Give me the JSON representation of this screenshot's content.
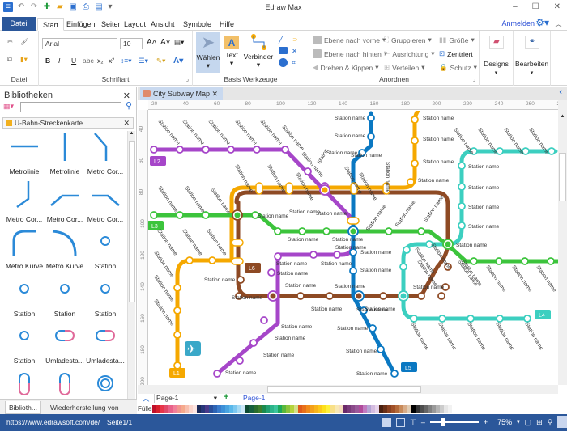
{
  "app": {
    "title": "Edraw Max",
    "window_controls": [
      "minimize-icon",
      "maximize-icon",
      "close-icon"
    ],
    "quick_access": [
      "app-logo-icon",
      "undo-icon",
      "redo-icon",
      "new-icon",
      "open-icon",
      "save-icon",
      "print-icon",
      "export-icon",
      "customize-icon"
    ]
  },
  "menu_tabs": [
    {
      "label": "Datei"
    },
    {
      "label": "Start",
      "active": true
    },
    {
      "label": "Einfügen"
    },
    {
      "label": "Seiten Layout"
    },
    {
      "label": "Ansicht"
    },
    {
      "label": "Symbole"
    },
    {
      "label": "Hilfe"
    }
  ],
  "account": {
    "signin_label": "Anmelden"
  },
  "ribbon": {
    "datei": {
      "label": "Datei"
    },
    "schriftart": {
      "label": "Schriftart",
      "font": "Arial",
      "size": "10"
    },
    "basis": {
      "label": "Basis Werkzeuge",
      "waehlen": "Wählen",
      "text": "Text",
      "verbinder": "Verbinder"
    },
    "anordnen": {
      "label": "Anordnen",
      "ebene_vorne": "Ebene nach vorne",
      "ebene_hinten": "Ebene nach hinten",
      "drehen": "Drehen & Kippen",
      "gruppieren": "Gruppieren",
      "ausrichtung": "Ausrichtung",
      "verteilen": "Verteilen",
      "groesse": "Größe",
      "zentriert": "Zentriert",
      "schutz": "Schutz"
    },
    "designs": "Designs",
    "bearbeiten": "Bearbeiten"
  },
  "sidebar": {
    "title": "Bibliotheken",
    "search_placeholder": "",
    "library": "U-Bahn-Streckenkarte",
    "shapes": [
      {
        "label": "Metrolinie",
        "kind": "h-line"
      },
      {
        "label": "Metrolinie",
        "kind": "v-line"
      },
      {
        "label": "Metro Cor...",
        "kind": "corner-a"
      },
      {
        "label": "Metro Cor...",
        "kind": "corner-b"
      },
      {
        "label": "Metro Cor...",
        "kind": "corner-c"
      },
      {
        "label": "Metro Cor...",
        "kind": "corner-d"
      },
      {
        "label": "Metro Kurve",
        "kind": "curve-a"
      },
      {
        "label": "Metro Kurve",
        "kind": "curve-b"
      },
      {
        "label": "Station",
        "kind": "station"
      },
      {
        "label": "Station",
        "kind": "station"
      },
      {
        "label": "Station",
        "kind": "station"
      },
      {
        "label": "Station",
        "kind": "station"
      },
      {
        "label": "Station",
        "kind": "station"
      },
      {
        "label": "Umladesta...",
        "kind": "transfer-h"
      },
      {
        "label": "Umladesta...",
        "kind": "transfer-h2"
      },
      {
        "label": "",
        "kind": "transfer-v"
      },
      {
        "label": "",
        "kind": "transfer-v"
      },
      {
        "label": "",
        "kind": "double-ring"
      }
    ],
    "bottom_tabs": [
      "Biblioth...",
      "Wiederherstellung von Da..."
    ]
  },
  "document": {
    "tab_title": "City Subway Map",
    "ruler_h": [
      "20",
      "40",
      "60",
      "80",
      "100",
      "120",
      "140",
      "160",
      "180",
      "200",
      "220",
      "240",
      "260",
      "28"
    ],
    "ruler_v": [
      "40",
      "60",
      "80",
      "100",
      "120",
      "140",
      "160",
      "180",
      "200"
    ],
    "station_label": "Station name",
    "short_label": "Station",
    "lines": [
      {
        "id": "L1",
        "color": "#f5a800"
      },
      {
        "id": "L2",
        "color": "#a646c9"
      },
      {
        "id": "L3",
        "color": "#3cc43c"
      },
      {
        "id": "L4",
        "color": "#3ccfc0"
      },
      {
        "id": "L5",
        "color": "#0a78c2"
      },
      {
        "id": "L6",
        "color": "#8e4a24"
      }
    ]
  },
  "pagebar": {
    "page_select": "Page-1",
    "add_icon": "plus-icon",
    "active_page": "Page-1"
  },
  "palette": {
    "label": "Füller",
    "colors": [
      "#c0102a",
      "#d8202c",
      "#e8354a",
      "#e04a6a",
      "#e8628a",
      "#f07f9a",
      "#f2958e",
      "#f5a98c",
      "#f8bfae",
      "#fbd5cc",
      "#fde6e2",
      "#1c2a5a",
      "#27367a",
      "#4a3a8a",
      "#2a4e9a",
      "#2e64b4",
      "#3a7ccc",
      "#3c90d8",
      "#4aa4e0",
      "#5ab8ea",
      "#7cc8f0",
      "#a6daf4",
      "#cce8f8",
      "#0e4a32",
      "#16603e",
      "#2a6e2e",
      "#3c7e2c",
      "#1a8a4e",
      "#22a070",
      "#2cb48a",
      "#3cc49c",
      "#1ca85a",
      "#5ab83c",
      "#8ac43c",
      "#b4d43c",
      "#d4e088",
      "#e05a1a",
      "#e8701a",
      "#f08a1a",
      "#f4a01a",
      "#f8b41a",
      "#fcc81a",
      "#fde01a",
      "#fef03a",
      "#f8e088",
      "#f8e8b4",
      "#f5dcbc",
      "#6a2a6a",
      "#7a3a7a",
      "#8a4a8a",
      "#9a5a9a",
      "#b04a9a",
      "#c07ac0",
      "#b4a4d4",
      "#d4bce0",
      "#e8d4ec",
      "#4a2010",
      "#6a3018",
      "#8a4020",
      "#a05028",
      "#b46a3a",
      "#c88a5a",
      "#d8ac88",
      "#e0ccb4",
      "#000000",
      "#333333",
      "#4d4d4d",
      "#666666",
      "#808080",
      "#999999",
      "#b3b3b3",
      "#cccccc",
      "#e6e6e6",
      "#f2f2f2"
    ]
  },
  "status": {
    "url": "https://www.edrawsoft.com/de/",
    "page": "Seite1/1",
    "zoom": "75%",
    "zoom_fraction": 0.25
  }
}
